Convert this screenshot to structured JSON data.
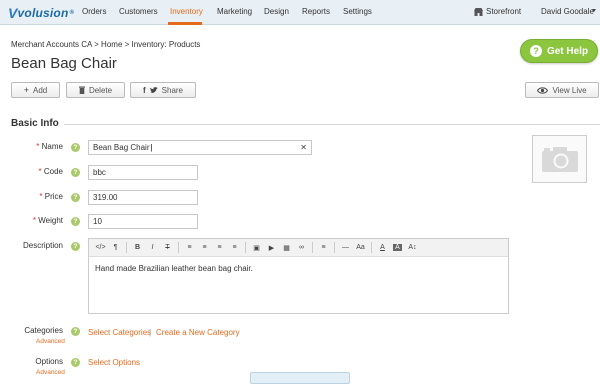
{
  "topbar": {
    "logo": {
      "mark": "V",
      "text": "volusion",
      "tm": "®"
    },
    "nav": [
      {
        "label": "Orders"
      },
      {
        "label": "Customers"
      },
      {
        "label": "Inventory"
      },
      {
        "label": "Marketing"
      },
      {
        "label": "Design"
      },
      {
        "label": "Reports"
      },
      {
        "label": "Settings"
      }
    ],
    "active_nav": "Inventory",
    "storefront": "Storefront",
    "user": "David Goodale"
  },
  "breadcrumb": "Merchant Accounts CA > Home > Inventory: Products",
  "page_title": "Bean Bag Chair",
  "help_button": {
    "label": "Get Help",
    "icon": "question-icon"
  },
  "toolbar": {
    "add": "Add",
    "delete": "Delete",
    "share": "Share",
    "view_live": "View Live"
  },
  "basic_info": {
    "title": "Basic Info",
    "name_label": "Name",
    "name_value": "Bean Bag Chair",
    "code_label": "Code",
    "code_value": "bbc",
    "price_label": "Price",
    "price_value": "319.00",
    "weight_label": "Weight",
    "weight_value": "10",
    "description_label": "Description",
    "description_value": "Hand made Brazilian leather bean bag chair.",
    "required_mark": "*",
    "help_mark": "?"
  },
  "editor_toolbar": [
    "</>",
    "¶",
    "B",
    "I",
    "T",
    "≡",
    "≡",
    "≡",
    "≡",
    "▣",
    "▶",
    "▦",
    "∞",
    "≡",
    "—",
    "Aa",
    "A",
    "A",
    "A↕"
  ],
  "categories": {
    "label": "Categories",
    "advanced": "Advanced",
    "select_link": "Select Categories",
    "separator": "|",
    "create_link": "Create a New Category"
  },
  "options": {
    "label": "Options",
    "advanced": "Advanced",
    "select_link": "Select Options"
  },
  "colors": {
    "accent": "#e46b1e",
    "help_green": "#8cc63f",
    "topbar_bg": "#e9f0f5"
  }
}
